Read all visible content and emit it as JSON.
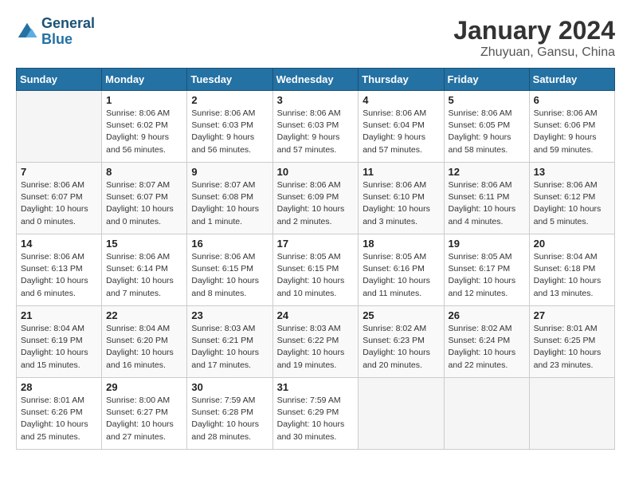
{
  "header": {
    "logo_general": "General",
    "logo_blue": "Blue",
    "title": "January 2024",
    "subtitle": "Zhuyuan, Gansu, China"
  },
  "weekdays": [
    "Sunday",
    "Monday",
    "Tuesday",
    "Wednesday",
    "Thursday",
    "Friday",
    "Saturday"
  ],
  "weeks": [
    [
      {
        "day": "",
        "sunrise": "",
        "sunset": "",
        "daylight": ""
      },
      {
        "day": "1",
        "sunrise": "Sunrise: 8:06 AM",
        "sunset": "Sunset: 6:02 PM",
        "daylight": "Daylight: 9 hours and 56 minutes."
      },
      {
        "day": "2",
        "sunrise": "Sunrise: 8:06 AM",
        "sunset": "Sunset: 6:03 PM",
        "daylight": "Daylight: 9 hours and 56 minutes."
      },
      {
        "day": "3",
        "sunrise": "Sunrise: 8:06 AM",
        "sunset": "Sunset: 6:03 PM",
        "daylight": "Daylight: 9 hours and 57 minutes."
      },
      {
        "day": "4",
        "sunrise": "Sunrise: 8:06 AM",
        "sunset": "Sunset: 6:04 PM",
        "daylight": "Daylight: 9 hours and 57 minutes."
      },
      {
        "day": "5",
        "sunrise": "Sunrise: 8:06 AM",
        "sunset": "Sunset: 6:05 PM",
        "daylight": "Daylight: 9 hours and 58 minutes."
      },
      {
        "day": "6",
        "sunrise": "Sunrise: 8:06 AM",
        "sunset": "Sunset: 6:06 PM",
        "daylight": "Daylight: 9 hours and 59 minutes."
      }
    ],
    [
      {
        "day": "7",
        "sunrise": "Sunrise: 8:06 AM",
        "sunset": "Sunset: 6:07 PM",
        "daylight": "Daylight: 10 hours and 0 minutes."
      },
      {
        "day": "8",
        "sunrise": "Sunrise: 8:07 AM",
        "sunset": "Sunset: 6:07 PM",
        "daylight": "Daylight: 10 hours and 0 minutes."
      },
      {
        "day": "9",
        "sunrise": "Sunrise: 8:07 AM",
        "sunset": "Sunset: 6:08 PM",
        "daylight": "Daylight: 10 hours and 1 minute."
      },
      {
        "day": "10",
        "sunrise": "Sunrise: 8:06 AM",
        "sunset": "Sunset: 6:09 PM",
        "daylight": "Daylight: 10 hours and 2 minutes."
      },
      {
        "day": "11",
        "sunrise": "Sunrise: 8:06 AM",
        "sunset": "Sunset: 6:10 PM",
        "daylight": "Daylight: 10 hours and 3 minutes."
      },
      {
        "day": "12",
        "sunrise": "Sunrise: 8:06 AM",
        "sunset": "Sunset: 6:11 PM",
        "daylight": "Daylight: 10 hours and 4 minutes."
      },
      {
        "day": "13",
        "sunrise": "Sunrise: 8:06 AM",
        "sunset": "Sunset: 6:12 PM",
        "daylight": "Daylight: 10 hours and 5 minutes."
      }
    ],
    [
      {
        "day": "14",
        "sunrise": "Sunrise: 8:06 AM",
        "sunset": "Sunset: 6:13 PM",
        "daylight": "Daylight: 10 hours and 6 minutes."
      },
      {
        "day": "15",
        "sunrise": "Sunrise: 8:06 AM",
        "sunset": "Sunset: 6:14 PM",
        "daylight": "Daylight: 10 hours and 7 minutes."
      },
      {
        "day": "16",
        "sunrise": "Sunrise: 8:06 AM",
        "sunset": "Sunset: 6:15 PM",
        "daylight": "Daylight: 10 hours and 8 minutes."
      },
      {
        "day": "17",
        "sunrise": "Sunrise: 8:05 AM",
        "sunset": "Sunset: 6:15 PM",
        "daylight": "Daylight: 10 hours and 10 minutes."
      },
      {
        "day": "18",
        "sunrise": "Sunrise: 8:05 AM",
        "sunset": "Sunset: 6:16 PM",
        "daylight": "Daylight: 10 hours and 11 minutes."
      },
      {
        "day": "19",
        "sunrise": "Sunrise: 8:05 AM",
        "sunset": "Sunset: 6:17 PM",
        "daylight": "Daylight: 10 hours and 12 minutes."
      },
      {
        "day": "20",
        "sunrise": "Sunrise: 8:04 AM",
        "sunset": "Sunset: 6:18 PM",
        "daylight": "Daylight: 10 hours and 13 minutes."
      }
    ],
    [
      {
        "day": "21",
        "sunrise": "Sunrise: 8:04 AM",
        "sunset": "Sunset: 6:19 PM",
        "daylight": "Daylight: 10 hours and 15 minutes."
      },
      {
        "day": "22",
        "sunrise": "Sunrise: 8:04 AM",
        "sunset": "Sunset: 6:20 PM",
        "daylight": "Daylight: 10 hours and 16 minutes."
      },
      {
        "day": "23",
        "sunrise": "Sunrise: 8:03 AM",
        "sunset": "Sunset: 6:21 PM",
        "daylight": "Daylight: 10 hours and 17 minutes."
      },
      {
        "day": "24",
        "sunrise": "Sunrise: 8:03 AM",
        "sunset": "Sunset: 6:22 PM",
        "daylight": "Daylight: 10 hours and 19 minutes."
      },
      {
        "day": "25",
        "sunrise": "Sunrise: 8:02 AM",
        "sunset": "Sunset: 6:23 PM",
        "daylight": "Daylight: 10 hours and 20 minutes."
      },
      {
        "day": "26",
        "sunrise": "Sunrise: 8:02 AM",
        "sunset": "Sunset: 6:24 PM",
        "daylight": "Daylight: 10 hours and 22 minutes."
      },
      {
        "day": "27",
        "sunrise": "Sunrise: 8:01 AM",
        "sunset": "Sunset: 6:25 PM",
        "daylight": "Daylight: 10 hours and 23 minutes."
      }
    ],
    [
      {
        "day": "28",
        "sunrise": "Sunrise: 8:01 AM",
        "sunset": "Sunset: 6:26 PM",
        "daylight": "Daylight: 10 hours and 25 minutes."
      },
      {
        "day": "29",
        "sunrise": "Sunrise: 8:00 AM",
        "sunset": "Sunset: 6:27 PM",
        "daylight": "Daylight: 10 hours and 27 minutes."
      },
      {
        "day": "30",
        "sunrise": "Sunrise: 7:59 AM",
        "sunset": "Sunset: 6:28 PM",
        "daylight": "Daylight: 10 hours and 28 minutes."
      },
      {
        "day": "31",
        "sunrise": "Sunrise: 7:59 AM",
        "sunset": "Sunset: 6:29 PM",
        "daylight": "Daylight: 10 hours and 30 minutes."
      },
      {
        "day": "",
        "sunrise": "",
        "sunset": "",
        "daylight": ""
      },
      {
        "day": "",
        "sunrise": "",
        "sunset": "",
        "daylight": ""
      },
      {
        "day": "",
        "sunrise": "",
        "sunset": "",
        "daylight": ""
      }
    ]
  ]
}
